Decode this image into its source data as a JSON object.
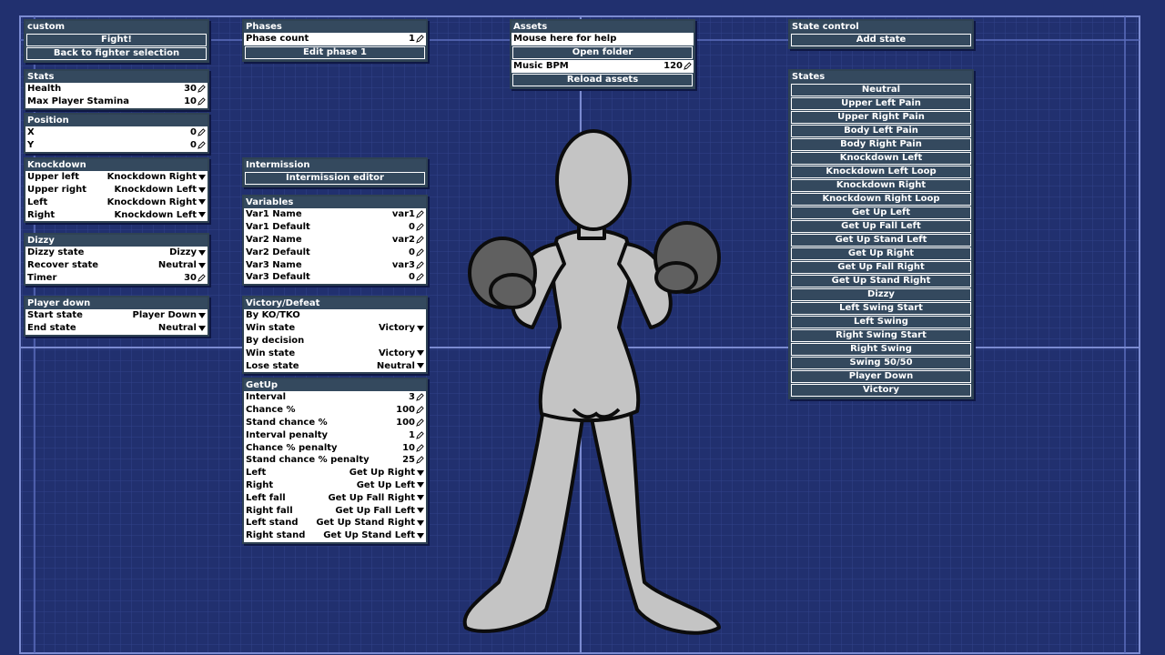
{
  "colors": {
    "background": "#21306f",
    "panel_header": "#34495e",
    "panel_body": "#ffffff",
    "figure_fill": "#c4c4c4",
    "glove_fill": "#606060"
  },
  "icons": {
    "edit": "pencil-icon",
    "dropdown": "triangle-down-icon"
  },
  "custom": {
    "title": "custom",
    "fight": "Fight!",
    "back": "Back to fighter selection"
  },
  "stats": {
    "title": "Stats",
    "health_label": "Health",
    "health": "30",
    "stamina_label": "Max Player Stamina",
    "stamina": "10"
  },
  "position": {
    "title": "Position",
    "x_label": "X",
    "x": "0",
    "y_label": "Y",
    "y": "0"
  },
  "knockdown": {
    "title": "Knockdown",
    "upper_left_label": "Upper left",
    "upper_left": "Knockdown Right",
    "upper_right_label": "Upper right",
    "upper_right": "Knockdown Left",
    "left_label": "Left",
    "left": "Knockdown Right",
    "right_label": "Right",
    "right": "Knockdown Left"
  },
  "dizzy": {
    "title": "Dizzy",
    "state_label": "Dizzy state",
    "state": "Dizzy",
    "recover_label": "Recover state",
    "recover": "Neutral",
    "timer_label": "Timer",
    "timer": "30"
  },
  "player_down": {
    "title": "Player down",
    "start_label": "Start state",
    "start": "Player Down",
    "end_label": "End state",
    "end": "Neutral"
  },
  "phases": {
    "title": "Phases",
    "count_label": "Phase count",
    "count": "1",
    "edit": "Edit phase 1"
  },
  "intermission": {
    "title": "Intermission",
    "editor": "Intermission editor"
  },
  "variables": {
    "title": "Variables",
    "v1n_label": "Var1 Name",
    "v1n": "var1",
    "v1d_label": "Var1 Default",
    "v1d": "0",
    "v2n_label": "Var2 Name",
    "v2n": "var2",
    "v2d_label": "Var2 Default",
    "v2d": "0",
    "v3n_label": "Var3 Name",
    "v3n": "var3",
    "v3d_label": "Var3 Default",
    "v3d": "0"
  },
  "victory": {
    "title": "Victory/Defeat",
    "ko_label": "By KO/TKO",
    "win1_label": "Win state",
    "win1": "Victory",
    "decision_label": "By decision",
    "win2_label": "Win state",
    "win2": "Victory",
    "lose_label": "Lose state",
    "lose": "Neutral"
  },
  "getup": {
    "title": "GetUp",
    "interval_label": "Interval",
    "interval": "3",
    "chance_label": "Chance %",
    "chance": "100",
    "stand_chance_label": "Stand chance %",
    "stand_chance": "100",
    "interval_penalty_label": "Interval penalty",
    "interval_penalty": "1",
    "chance_penalty_label": "Chance % penalty",
    "chance_penalty": "10",
    "stand_penalty_label": "Stand chance % penalty",
    "stand_penalty": "25",
    "left_label": "Left",
    "left": "Get Up Right",
    "right_label": "Right",
    "right": "Get Up Left",
    "left_fall_label": "Left fall",
    "left_fall": "Get Up Fall Right",
    "right_fall_label": "Right fall",
    "right_fall": "Get Up Fall Left",
    "left_stand_label": "Left stand",
    "left_stand": "Get Up Stand Right",
    "right_stand_label": "Right stand",
    "right_stand": "Get Up Stand Left"
  },
  "assets": {
    "title": "Assets",
    "help": "Mouse here for help",
    "open": "Open folder",
    "bpm_label": "Music BPM",
    "bpm": "120",
    "reload": "Reload assets"
  },
  "state_control": {
    "title": "State control",
    "add": "Add state"
  },
  "states": {
    "title": "States",
    "items": [
      "Neutral",
      "Upper Left Pain",
      "Upper Right Pain",
      "Body Left Pain",
      "Body Right Pain",
      "Knockdown Left",
      "Knockdown Left Loop",
      "Knockdown Right",
      "Knockdown Right Loop",
      "Get Up Left",
      "Get Up Fall Left",
      "Get Up Stand Left",
      "Get Up Right",
      "Get Up Fall Right",
      "Get Up Stand Right",
      "Dizzy",
      "Left Swing Start",
      "Left Swing",
      "Right Swing Start",
      "Right Swing",
      "Swing 50/50",
      "Player Down",
      "Victory"
    ]
  }
}
